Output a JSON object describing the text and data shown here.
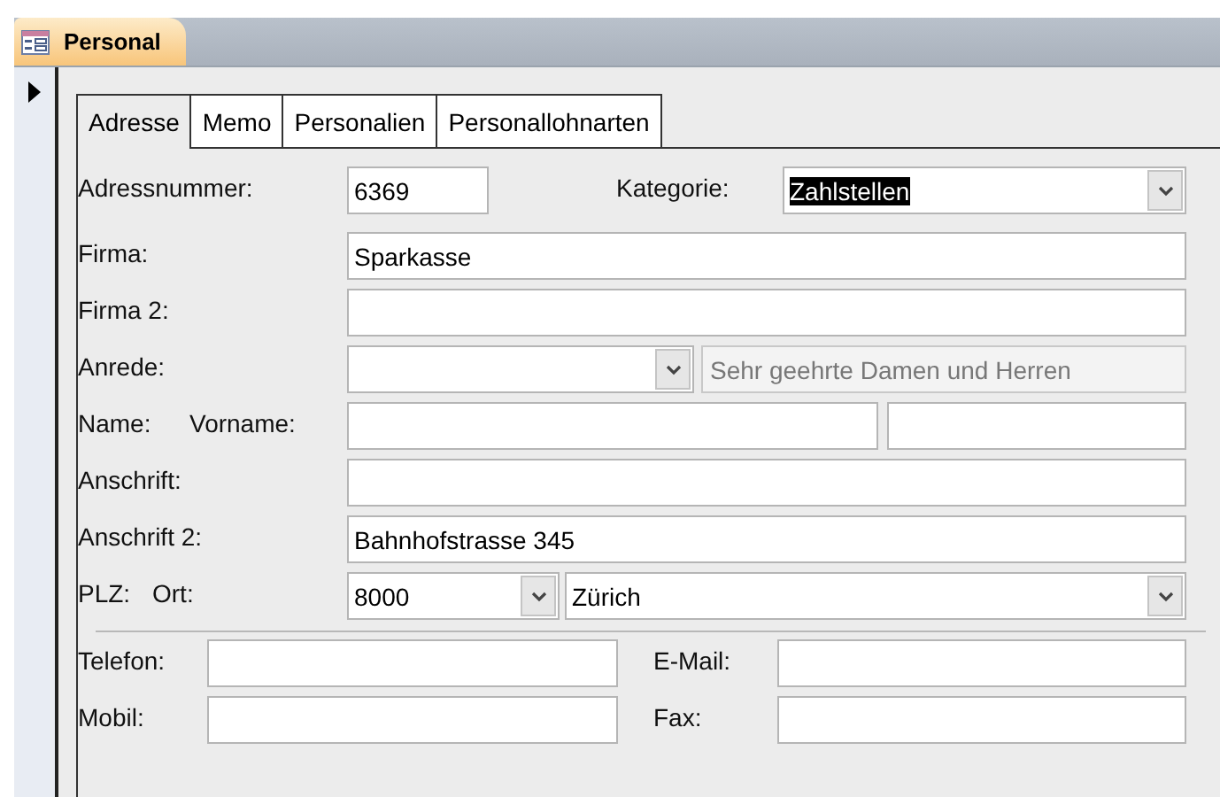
{
  "document_tab": {
    "title": "Personal"
  },
  "tabs": [
    {
      "label": "Adresse",
      "selected": true
    },
    {
      "label": "Memo",
      "selected": false
    },
    {
      "label": "Personalien",
      "selected": false
    },
    {
      "label": "Personallohnarten",
      "selected": false
    }
  ],
  "rows": [
    {
      "items": [
        {
          "kind": "label",
          "text": "Adressnummer:"
        },
        {
          "kind": "text",
          "value": "6369"
        },
        {
          "kind": "label",
          "text": "Kategorie:"
        },
        {
          "kind": "combo",
          "value": "Zahlstellen",
          "text_selected": true
        }
      ]
    },
    {
      "items": [
        {
          "kind": "label",
          "text": "Firma:"
        },
        {
          "kind": "text",
          "value": "Sparkasse"
        }
      ]
    },
    {
      "items": [
        {
          "kind": "label",
          "text": "Firma 2:"
        },
        {
          "kind": "text"
        }
      ]
    },
    {
      "items": [
        {
          "kind": "label",
          "text": "Anrede:"
        },
        {
          "kind": "combo"
        },
        {
          "kind": "note",
          "value": "Sehr geehrte Damen und Herren"
        }
      ]
    },
    {
      "items": [
        {
          "kind": "label",
          "text": "Name:"
        },
        {
          "kind": "label",
          "text": "Vorname:"
        },
        {
          "kind": "text"
        },
        {
          "kind": "text"
        }
      ]
    },
    {
      "items": [
        {
          "kind": "label",
          "text": "Anschrift:"
        },
        {
          "kind": "text"
        }
      ]
    },
    {
      "items": [
        {
          "kind": "label",
          "text": "Anschrift 2:"
        },
        {
          "kind": "text",
          "value": "Bahnhofstrasse 345"
        }
      ]
    },
    {
      "items": [
        {
          "kind": "label",
          "text": "PLZ:"
        },
        {
          "kind": "label",
          "text": "Ort:"
        },
        {
          "kind": "combo",
          "value": "8000",
          "text_selected": false
        },
        {
          "kind": "combo",
          "value": "Zürich",
          "text_selected": false
        }
      ]
    }
  ],
  "contact_rows": [
    {
      "items": [
        {
          "kind": "label",
          "text": "Telefon:"
        },
        {
          "kind": "text"
        },
        {
          "kind": "label",
          "text": "E-Mail:"
        },
        {
          "kind": "text"
        }
      ]
    },
    {
      "items": [
        {
          "kind": "label",
          "text": "Mobil:"
        },
        {
          "kind": "text"
        },
        {
          "kind": "label",
          "text": "Fax:"
        },
        {
          "kind": "text"
        }
      ]
    }
  ]
}
